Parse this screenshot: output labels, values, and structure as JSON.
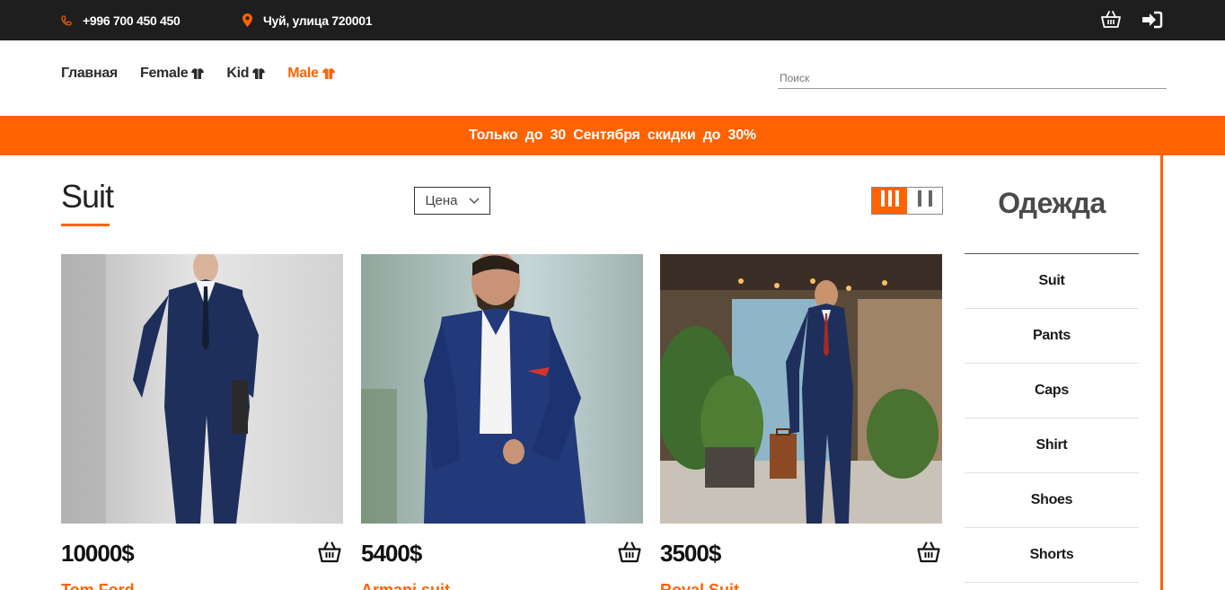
{
  "topbar": {
    "phone": "+996 700 450 450",
    "address": "Чуй, улица 720001",
    "phone_icon": "phone-icon",
    "address_icon": "map-pin-icon",
    "cart_icon": "basket-icon",
    "login_icon": "sign-in-icon"
  },
  "nav": {
    "items": [
      {
        "label": "Главная",
        "active": false,
        "icon": null
      },
      {
        "label": "Female",
        "active": false,
        "icon": "shirt-icon"
      },
      {
        "label": "Kid",
        "active": false,
        "icon": "shirt-icon"
      },
      {
        "label": "Male",
        "active": true,
        "icon": "shirt-icon"
      }
    ],
    "search_placeholder": "Поиск"
  },
  "promo": {
    "text": "Только до 30 Сентября скидки до 30%"
  },
  "catalog": {
    "title": "Suit",
    "sort_label": "Цена",
    "view_modes": [
      "three-columns",
      "two-columns"
    ],
    "active_view": "three-columns"
  },
  "products": [
    {
      "price": "10000$",
      "name": "Tom Ford"
    },
    {
      "price": "5400$",
      "name": "Armani suit"
    },
    {
      "price": "3500$",
      "name": "Royal Suit"
    }
  ],
  "sidebar": {
    "title": "Одежда",
    "items": [
      "Suit",
      "Pants",
      "Caps",
      "Shirt",
      "Shoes",
      "Shorts"
    ]
  },
  "colors": {
    "accent": "#ff6200",
    "topbar_bg": "#1e1e1e",
    "suit_navy": "#1f2f5c"
  }
}
